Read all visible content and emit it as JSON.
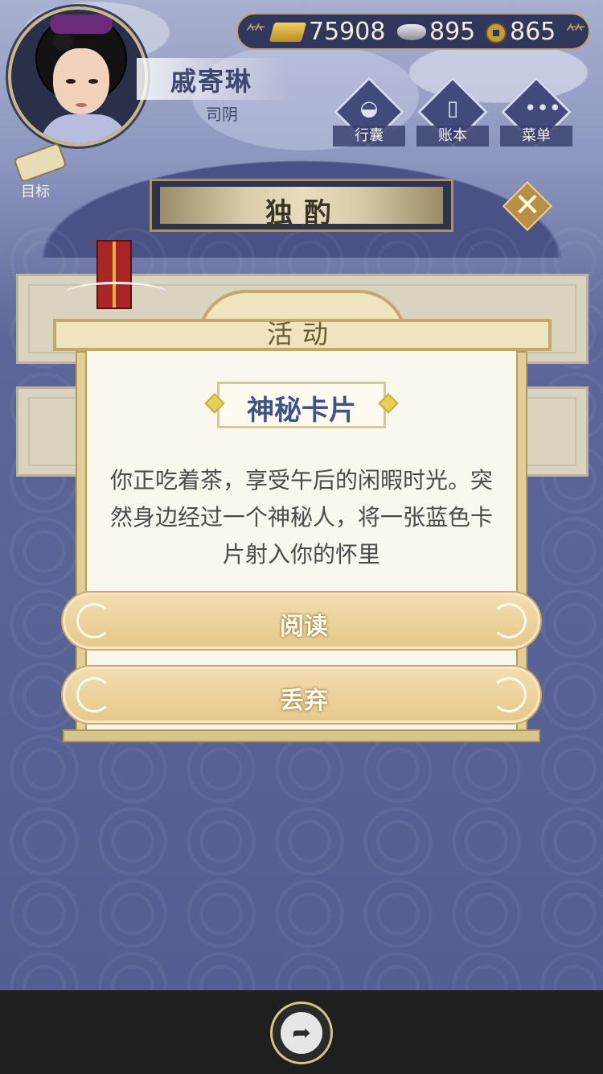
{
  "player": {
    "name": "戚寄琳",
    "title": "司阴"
  },
  "currency": {
    "gold": "75908",
    "silver": "895",
    "coins": "865"
  },
  "nav": {
    "bag": "行囊",
    "ledger": "账本",
    "menu": "菜单",
    "goal": "目标"
  },
  "banner": {
    "title": "独酌"
  },
  "modal": {
    "header": "活动",
    "card_name": "神秘卡片",
    "story": "你正吃着茶，享受午后的闲暇时光。突然身边经过一个神秘人，将一张蓝色卡片射入你的怀里",
    "choices": {
      "read": "阅读",
      "discard": "丢弃"
    }
  },
  "icons": {
    "gold": "gold-ingot-icon",
    "silver": "silver-ingot-icon",
    "coin": "copper-coin-icon",
    "bag": "bag-icon",
    "ledger": "ledger-icon",
    "menu": "more-icon",
    "goal": "scroll-icon",
    "close": "close-icon",
    "share": "share-icon"
  },
  "colors": {
    "accent_gold": "#c4a86a",
    "nav_blue": "#424a7c",
    "card_title_blue": "#3f5486"
  }
}
